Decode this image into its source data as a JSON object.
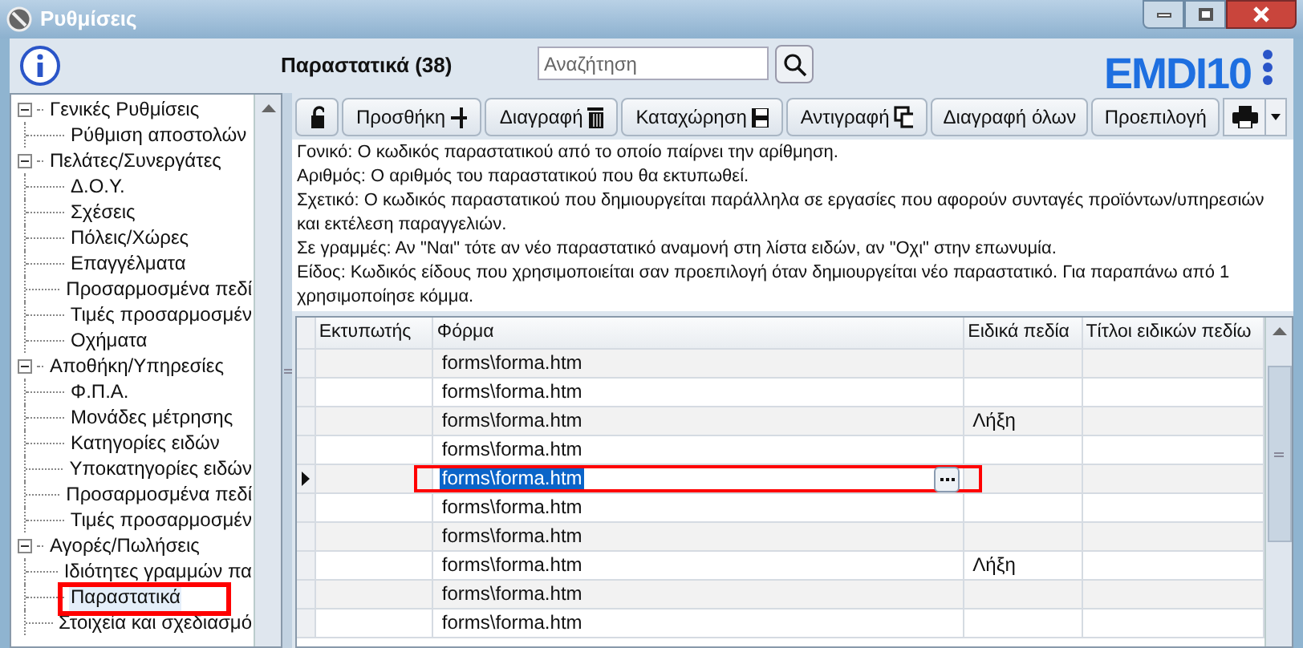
{
  "window": {
    "title": "Ρυθμίσεις"
  },
  "header": {
    "title": "Παραστατικά (38)",
    "search": {
      "placeholder": "Αναζήτηση"
    },
    "logo": "EMDI10"
  },
  "tree": [
    {
      "label": "Γενικές Ρυθμίσεις",
      "expanded": true,
      "selected": false,
      "children": [
        {
          "label": "Ρύθμιση αποστολών",
          "selected": false
        }
      ]
    },
    {
      "label": "Πελάτες/Συνεργάτες",
      "expanded": true,
      "selected": false,
      "children": [
        {
          "label": "Δ.Ο.Υ.",
          "selected": false
        },
        {
          "label": "Σχέσεις",
          "selected": false
        },
        {
          "label": "Πόλεις/Χώρες",
          "selected": false
        },
        {
          "label": "Επαγγέλματα",
          "selected": false
        },
        {
          "label": "Προσαρμοσμένα πεδί",
          "selected": false
        },
        {
          "label": "Τιμές προσαρμοσμέν",
          "selected": false
        },
        {
          "label": "Οχήματα",
          "selected": false
        }
      ]
    },
    {
      "label": "Αποθήκη/Υπηρεσίες",
      "expanded": true,
      "selected": false,
      "children": [
        {
          "label": "Φ.Π.Α.",
          "selected": false
        },
        {
          "label": "Μονάδες μέτρησης",
          "selected": false
        },
        {
          "label": "Κατηγορίες ειδών",
          "selected": false
        },
        {
          "label": "Υποκατηγορίες ειδών",
          "selected": false
        },
        {
          "label": "Προσαρμοσμένα πεδί",
          "selected": false
        },
        {
          "label": "Τιμές προσαρμοσμέν",
          "selected": false
        }
      ]
    },
    {
      "label": "Αγορές/Πωλήσεις",
      "expanded": true,
      "selected": false,
      "children": [
        {
          "label": "Ιδιότητες γραμμών πα",
          "selected": false
        },
        {
          "label": "Παραστατικά",
          "selected": true
        },
        {
          "label": "Στοιχεία και σχεδιασμό",
          "selected": false
        }
      ]
    }
  ],
  "toolbar": [
    {
      "kind": "lock"
    },
    {
      "kind": "add",
      "label": "Προσθήκη"
    },
    {
      "kind": "delete",
      "label": "Διαγραφή"
    },
    {
      "kind": "save",
      "label": "Καταχώρηση"
    },
    {
      "kind": "copy",
      "label": "Αντιγραφή"
    },
    {
      "kind": "text",
      "label": "Διαγραφή όλων"
    },
    {
      "kind": "text",
      "label": "Προεπιλογή"
    },
    {
      "kind": "print"
    }
  ],
  "description": [
    "Γονικό: Ο κωδικός παραστατικού από το οποίο παίρνει την αρίθμηση.",
    "Αριθμός: Ο αριθμός του παραστατικού που θα εκτυπωθεί.",
    "Σχετικό: Ο κωδικός παραστατικού που δημιουργείται παράλληλα σε εργασίες που αφορούν συνταγές προϊόντων/υπηρεσιών και εκτέλεση παραγγελιών.",
    "Σε γραμμές: Αν \"Ναι\" τότε αν νέο παραστατικό αναμονή στη λίστα ειδών, αν \"Οχι\" στην επωνυμία.",
    "Είδος: Κωδικός είδους που χρησιμοποιείται σαν προεπιλογή όταν δημιουργείται νέο παραστατικό. Για παραπάνω από 1 χρησιμοποίησε κόμμα."
  ],
  "table": {
    "columns": [
      "Εκτυπωτής",
      "Φόρμα",
      "Ειδικά πεδία",
      "Τίτλοι ειδικών πεδίω"
    ],
    "rows": [
      {
        "selected": false,
        "cells": [
          "",
          "forms\\forma.htm",
          "",
          ""
        ]
      },
      {
        "selected": false,
        "cells": [
          "",
          "forms\\forma.htm",
          "",
          ""
        ]
      },
      {
        "selected": false,
        "cells": [
          "",
          "forms\\forma.htm",
          "Λήξη",
          ""
        ]
      },
      {
        "selected": false,
        "cells": [
          "",
          "forms\\forma.htm",
          "",
          ""
        ]
      },
      {
        "selected": true,
        "cells": [
          "",
          "forms\\forma.htm",
          "",
          ""
        ]
      },
      {
        "selected": false,
        "cells": [
          "",
          "forms\\forma.htm",
          "",
          ""
        ]
      },
      {
        "selected": false,
        "cells": [
          "",
          "forms\\forma.htm",
          "",
          ""
        ]
      },
      {
        "selected": false,
        "cells": [
          "",
          "forms\\forma.htm",
          "Λήξη",
          ""
        ]
      },
      {
        "selected": false,
        "cells": [
          "",
          "forms\\forma.htm",
          "",
          ""
        ]
      },
      {
        "selected": false,
        "cells": [
          "",
          "forms\\forma.htm",
          "",
          ""
        ]
      }
    ]
  }
}
